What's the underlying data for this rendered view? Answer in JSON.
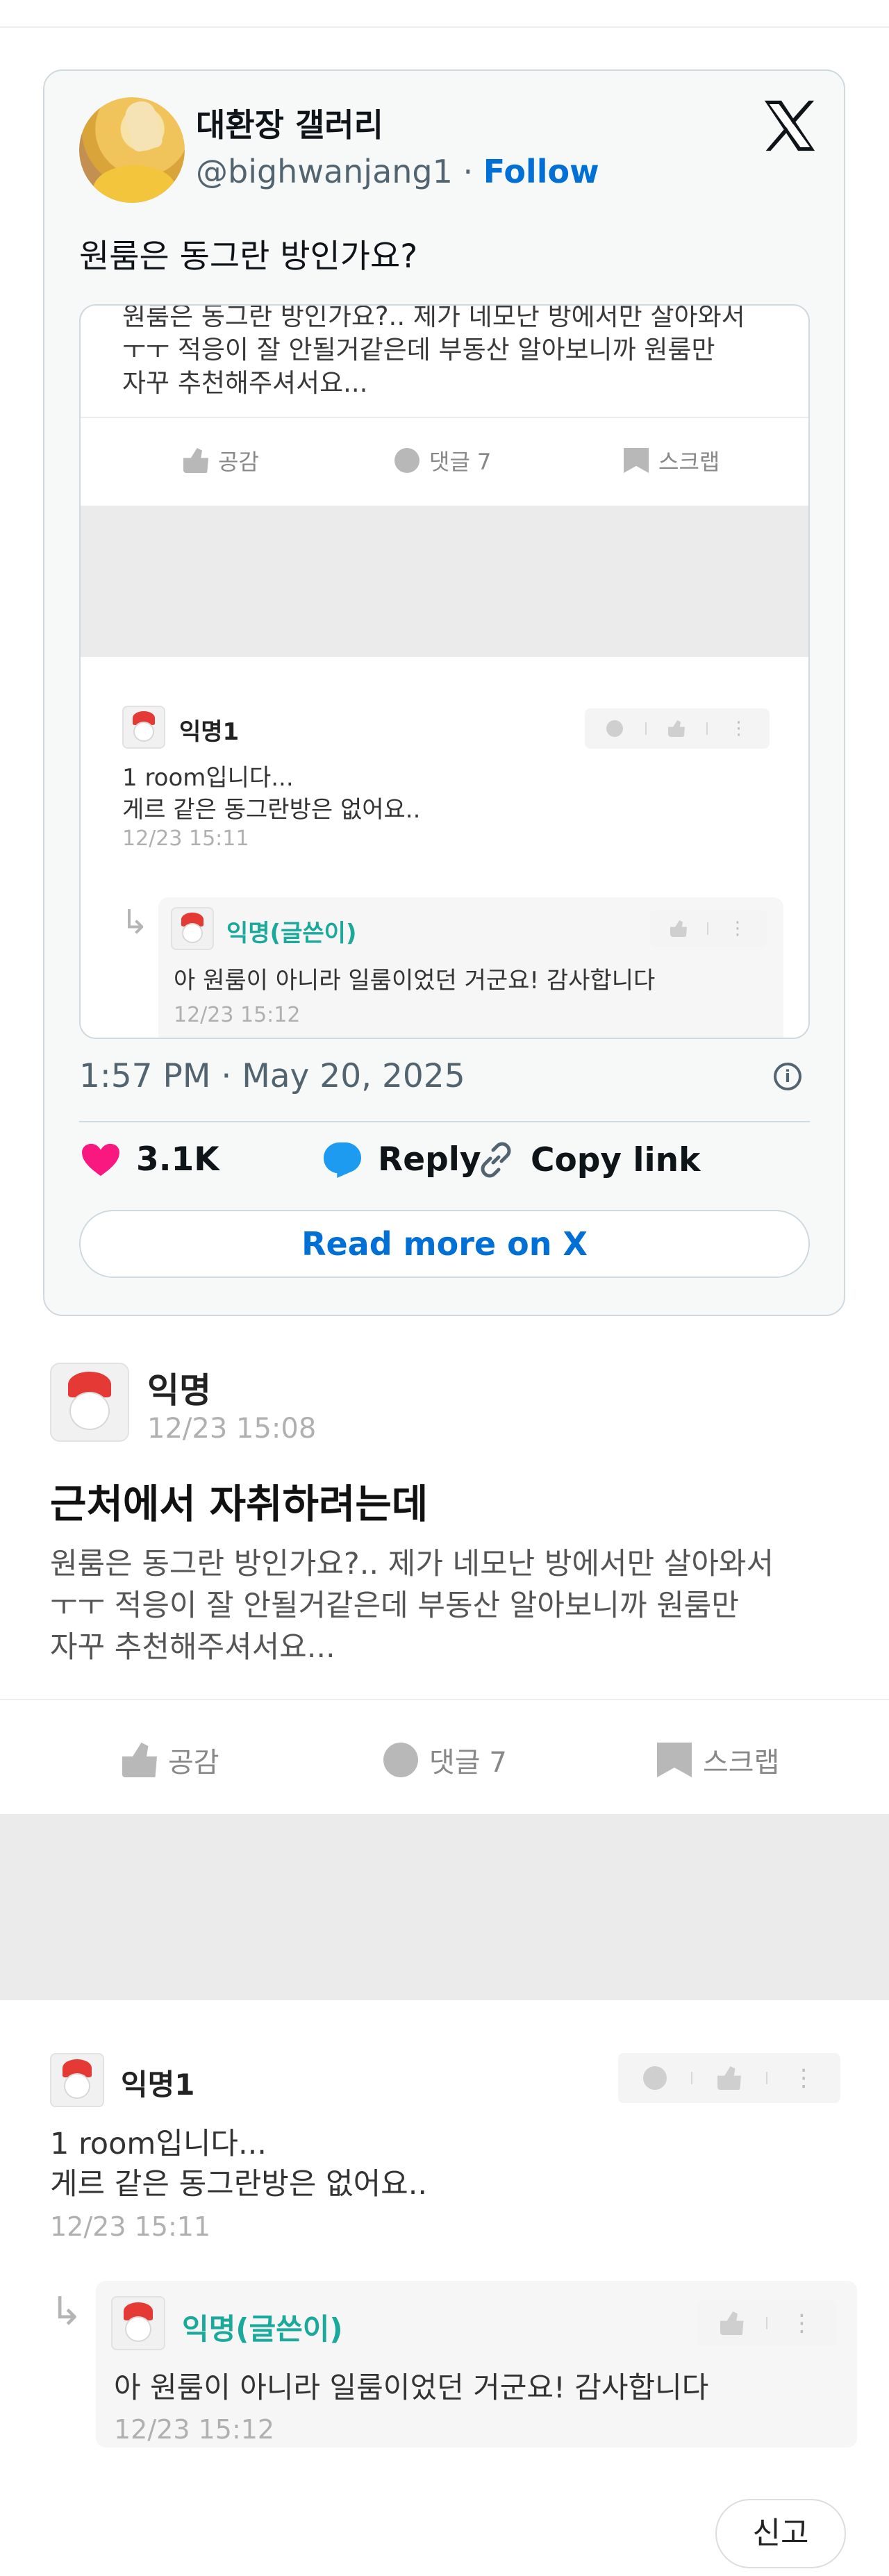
{
  "tweet": {
    "display_name": "대환장 갤러리",
    "handle": "@bighwanjang1",
    "separator": "·",
    "follow_label": "Follow",
    "text": "원룸은 동그란 방인가요?",
    "timestamp": "1:57 PM · May 20, 2025",
    "likes": "3.1K",
    "reply_label": "Reply",
    "copy_link_label": "Copy link",
    "read_more_label": "Read more on X",
    "brand_color": "#006fd6",
    "heart_color": "#f91880"
  },
  "post": {
    "author": "익명",
    "date": "12/23 15:08",
    "title": "근처에서 자취하려는데",
    "body_lines": [
      "원룸은 동그란 방인가요?.. 제가 네모난 방에서만 살아와서",
      "ㅜㅜ 적응이 잘 안될거같은데 부동산 알아보니까 원룸만",
      "자꾸 추천해주셔서요..."
    ],
    "actions": {
      "like": "공감",
      "comment": "댓글 7",
      "scrap": "스크랩"
    }
  },
  "comments": [
    {
      "author": "익명1",
      "lines": [
        "1 room입니다...",
        "게르 같은 동그란방은 없어요.."
      ],
      "date": "12/23 15:11"
    }
  ],
  "reply": {
    "author": "익명(글쓴이)",
    "text": "아 원룸이 아니라 일룸이었던 거군요! 감사합니다",
    "date": "12/23 15:12",
    "arrow": "↳"
  },
  "report_label": "신고"
}
